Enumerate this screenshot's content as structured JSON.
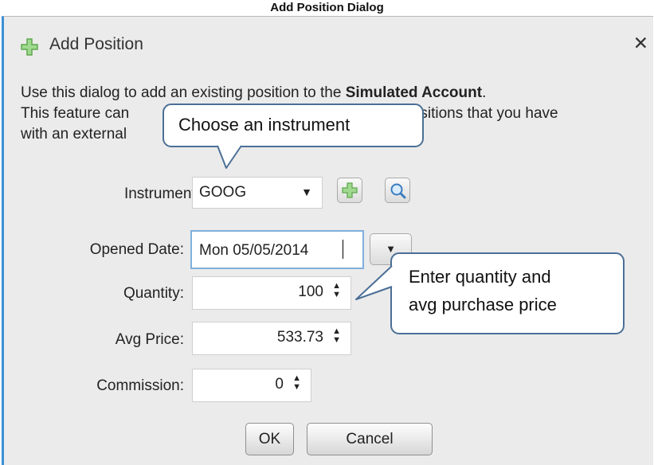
{
  "caption": "Add Position Dialog",
  "dialog": {
    "title": "Add Position",
    "title_icon": "green-plus-icon",
    "close_icon": "close-icon",
    "intro_line1_a": "Use this dialog to add an existing position to the ",
    "intro_line1_b": "Simulated Account",
    "intro_line1_c": ".",
    "intro_line2_a": "This feature can",
    "intro_line2_b": "positions that you have",
    "intro_line3": "with an external"
  },
  "form": {
    "instrument_label": "Instrument:",
    "instrument_value": "GOOG",
    "add_instrument_icon": "green-plus-icon",
    "search_instrument_icon": "magnifier-icon",
    "opened_date_label": "Opened Date:",
    "opened_date_value": "Mon 05/05/2014",
    "quantity_label": "Quantity:",
    "quantity_value": "100",
    "avg_price_label": "Avg Price:",
    "avg_price_value": "533.73",
    "commission_label": "Commission:",
    "commission_value": "0"
  },
  "buttons": {
    "ok": "OK",
    "cancel": "Cancel"
  },
  "callouts": {
    "instrument": "Choose an instrument",
    "quantity_line1": "Enter quantity and",
    "quantity_line2": "avg purchase price"
  },
  "colors": {
    "accent_border": "#3d8fd6",
    "callout_border": "#4b6f96",
    "plus_green": "#7cc576"
  }
}
